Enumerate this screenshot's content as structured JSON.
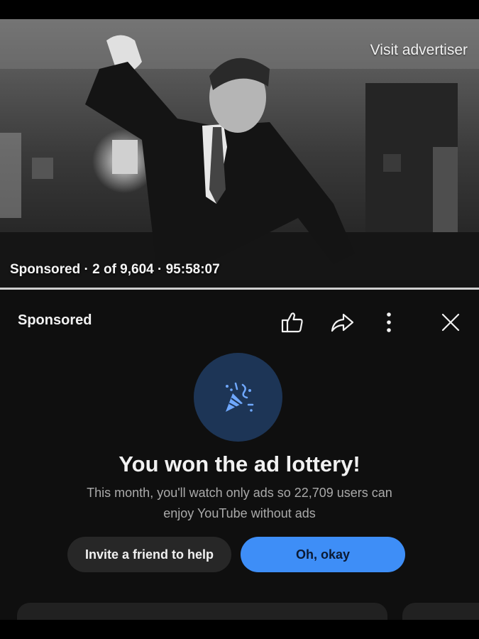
{
  "video": {
    "visit_advertiser": "Visit advertiser",
    "info": "Sponsored · 2 of 9,604 · 95:58:07"
  },
  "panel": {
    "sponsored_label": "Sponsored",
    "icons": [
      "thumbs-up-icon",
      "share-icon",
      "more-vert-icon",
      "close-icon",
      "party-popper-icon"
    ],
    "headline": "You won the ad lottery!",
    "subtext": "This month, you'll watch only ads so 22,709 users can enjoy YouTube without ads",
    "invite_button": "Invite a friend to help",
    "ok_button": "Oh, okay"
  },
  "colors": {
    "panel_bg": "#0f0f0f",
    "accent": "#3e8ef7",
    "icon_circle": "#1d3556",
    "secondary_button": "#272727"
  }
}
